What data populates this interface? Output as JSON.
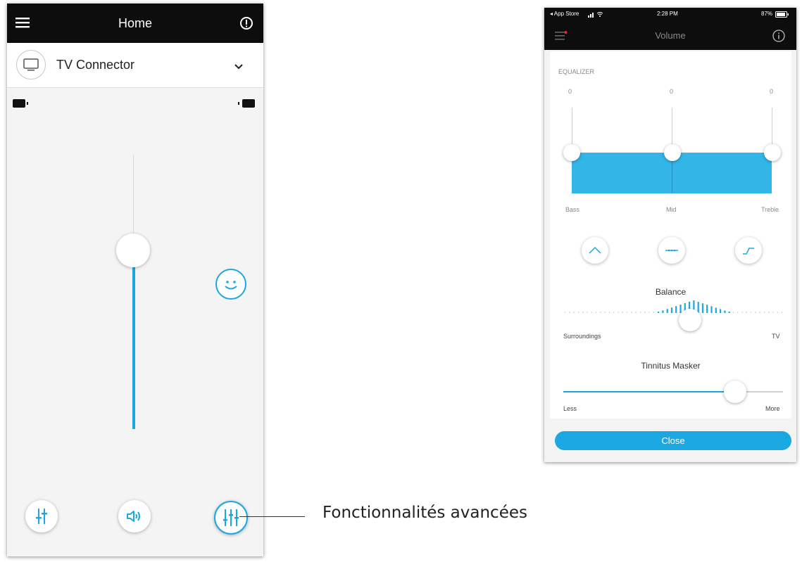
{
  "left_phone": {
    "header": {
      "title": "Home",
      "menu_icon": "hamburger-icon",
      "info_icon": "info-icon"
    },
    "device": {
      "name": "TV Connector",
      "icon": "tv-icon",
      "dropdown_icon": "chevron-down-icon"
    },
    "volume": {
      "level": 0.65
    },
    "bottom_buttons": [
      {
        "name": "adjust-button",
        "icon": "sliders-icon"
      },
      {
        "name": "speaker-button",
        "icon": "speaker-icon"
      },
      {
        "name": "advanced-button",
        "icon": "equalizer-icon"
      }
    ]
  },
  "callout": {
    "text": "Fonctionnalités avancées"
  },
  "right_phone": {
    "status": {
      "carrier": "◂ App Store",
      "time": "2:28 PM",
      "battery": "87%"
    },
    "header": {
      "title": "Volume"
    },
    "equalizer": {
      "section_label": "EQUALIZER",
      "bands": [
        {
          "label": "Bass",
          "value": "0"
        },
        {
          "label": "Mid",
          "value": "0"
        },
        {
          "label": "Treble",
          "value": "0"
        }
      ]
    },
    "balance": {
      "title": "Balance",
      "left_label": "Surroundings",
      "right_label": "TV",
      "position": 0.59
    },
    "tinnitus": {
      "title": "Tinnitus Masker",
      "left_label": "Less",
      "right_label": "More",
      "level": 0.78
    },
    "close_label": "Close"
  },
  "colors": {
    "accent": "#1ba8e2",
    "header": "#0d0d0d",
    "eq_fill": "#33b5e8"
  }
}
